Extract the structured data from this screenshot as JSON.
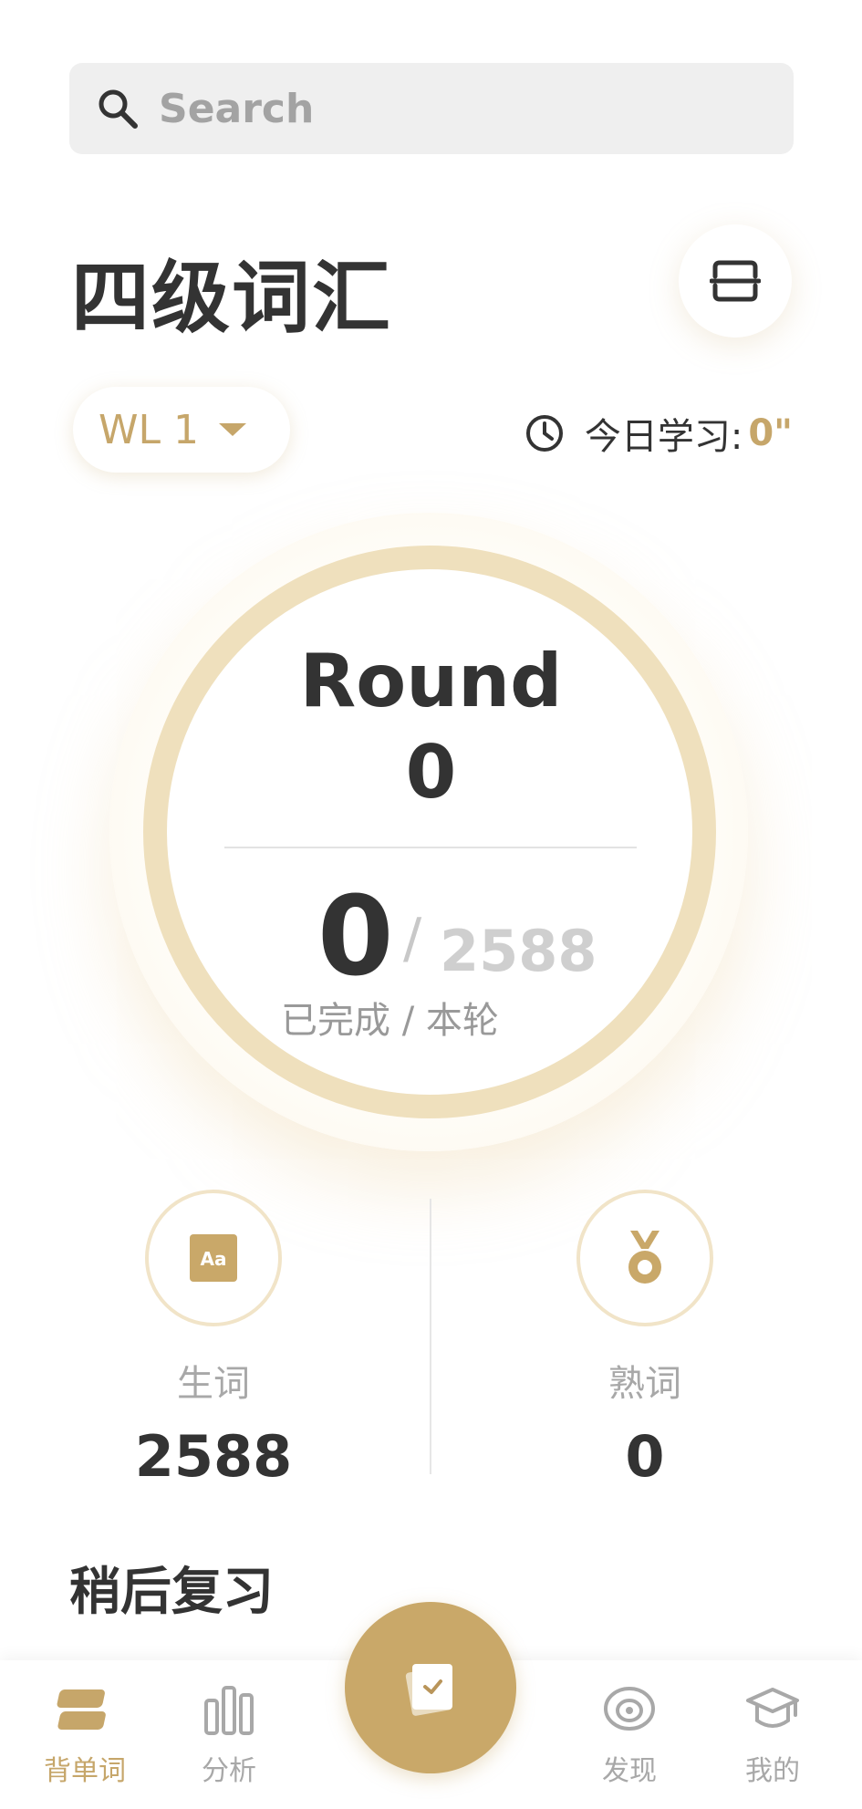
{
  "search": {
    "placeholder": "Search"
  },
  "header": {
    "title": "四级词汇"
  },
  "wordlist": {
    "label": "WL 1"
  },
  "today": {
    "label": "今日学习:",
    "value": "0\""
  },
  "progress": {
    "round_label": "Round",
    "round_value": "0",
    "completed": "0",
    "separator": "/",
    "total": "2588",
    "caption": "已完成 / 本轮"
  },
  "stats": {
    "new_words": {
      "label": "生词",
      "value": "2588",
      "icon": "aa-card-icon"
    },
    "known_words": {
      "label": "熟词",
      "value": "0",
      "icon": "medal-icon"
    }
  },
  "section": {
    "review_later": "稍后复习"
  },
  "nav": {
    "items": [
      {
        "label": "背单词",
        "icon": "stack-icon",
        "active": true
      },
      {
        "label": "分析",
        "icon": "bar-chart-icon",
        "active": false
      },
      {
        "label": "发现",
        "icon": "eye-icon",
        "active": false
      },
      {
        "label": "我的",
        "icon": "graduation-cap-icon",
        "active": false
      }
    ],
    "fab_icon": "check-card-icon"
  },
  "colors": {
    "accent": "#c6a66a",
    "ring": "#efe0bd",
    "text": "#333333",
    "muted": "#a8a8a8"
  }
}
